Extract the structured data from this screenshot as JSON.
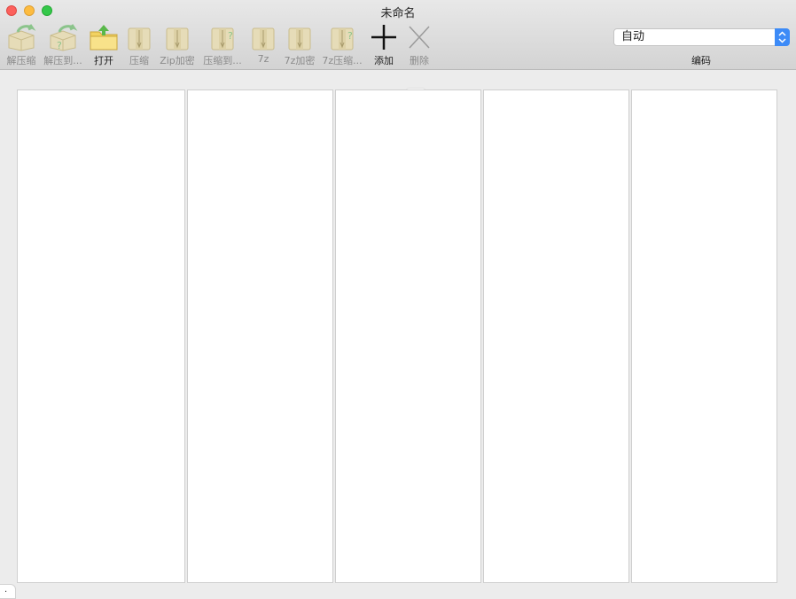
{
  "window": {
    "title": "未命名"
  },
  "toolbar": {
    "items": [
      {
        "label": "解压缩",
        "icon": "box-extract-icon",
        "enabled": false
      },
      {
        "label": "解压到...",
        "icon": "box-extract-to-icon",
        "enabled": false
      },
      {
        "label": "打开",
        "icon": "open-folder-icon",
        "enabled": true
      },
      {
        "label": "压缩",
        "icon": "archive-compress-icon",
        "enabled": false
      },
      {
        "label": "Zip加密",
        "icon": "zip-encrypt-icon",
        "enabled": false
      },
      {
        "label": "压缩到...",
        "icon": "archive-compress-to-icon",
        "enabled": false
      },
      {
        "label": "7z",
        "icon": "archive-7z-icon",
        "enabled": false
      },
      {
        "label": "7z加密",
        "icon": "archive-7z-encrypt-icon",
        "enabled": false
      },
      {
        "label": "7z压缩...",
        "icon": "archive-7z-compress-to-icon",
        "enabled": false
      },
      {
        "label": "添加",
        "icon": "plus-icon",
        "enabled": true
      },
      {
        "label": "删除",
        "icon": "cross-icon",
        "enabled": false
      }
    ]
  },
  "encoding": {
    "value": "自动",
    "label": "编码"
  },
  "status": {
    "text": "."
  },
  "colors": {
    "accent": "#3d8bf7",
    "close": "#fc605c",
    "minimize": "#fdbc40",
    "maximize": "#34c84a"
  }
}
